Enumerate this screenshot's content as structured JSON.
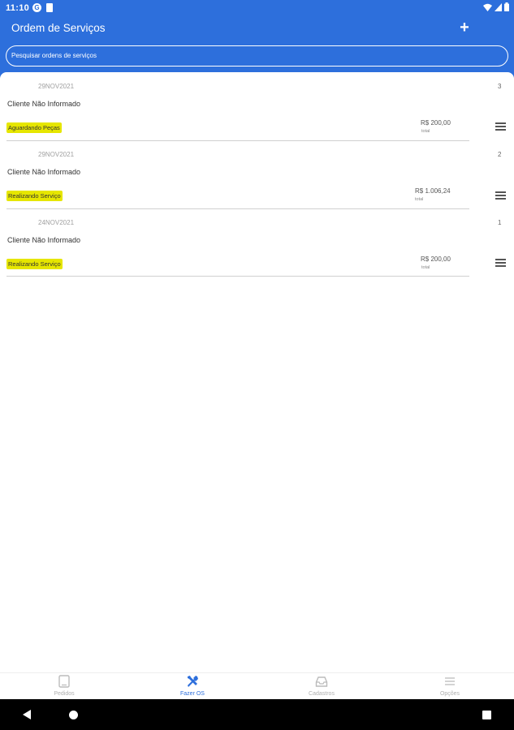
{
  "statusbar": {
    "time": "11:10",
    "g_icon": "G"
  },
  "header": {
    "title": "Ordem de Serviços",
    "add_label": "+",
    "search_placeholder": "Pesquisar ordens de serviços"
  },
  "orders": [
    {
      "date": "29NOV2021",
      "number": "3",
      "client": "Cliente Não Informado",
      "status": "Aguardando Peças",
      "price": "R$ 200,00",
      "price_label": "total"
    },
    {
      "date": "29NOV2021",
      "number": "2",
      "client": "Cliente Não Informado",
      "status": "Realizando Serviço",
      "price": "R$ 1.006,24",
      "price_label": "total"
    },
    {
      "date": "24NOV2021",
      "number": "1",
      "client": "Cliente Não Informado",
      "status": "Realizando Serviço",
      "price": "R$ 200,00",
      "price_label": "total"
    }
  ],
  "bottom_nav": {
    "items": [
      {
        "label": "Pedidos",
        "icon": "tablet-icon",
        "active": false
      },
      {
        "label": "Fazer OS",
        "icon": "tools-icon",
        "active": true
      },
      {
        "label": "Cadastros",
        "icon": "inbox-icon",
        "active": false
      },
      {
        "label": "Opções",
        "icon": "menu-icon",
        "active": false
      }
    ]
  },
  "colors": {
    "accent": "#2d6fdc",
    "status_highlight": "#e6e600"
  }
}
